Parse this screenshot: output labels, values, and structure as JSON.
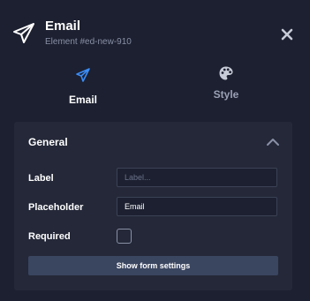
{
  "header": {
    "title": "Email",
    "subtitle": "Element #ed-new-910",
    "icon": "paper-plane-icon",
    "close_icon": "close-icon"
  },
  "tabs": [
    {
      "label": "Email",
      "icon": "paper-plane-icon",
      "active": true,
      "color": "#3b8cf5"
    },
    {
      "label": "Style",
      "icon": "palette-icon",
      "active": false,
      "color": "#b8bccb"
    }
  ],
  "section": {
    "title": "General",
    "expanded": true,
    "fields": {
      "label": {
        "label": "Label",
        "value": "",
        "placeholder": "Label..."
      },
      "placeholder": {
        "label": "Placeholder",
        "value": "Email",
        "placeholder": ""
      },
      "required": {
        "label": "Required",
        "checked": false
      }
    },
    "button_label": "Show form settings"
  },
  "colors": {
    "background": "#1c2030",
    "section_bg": "#242838",
    "accent": "#3b8cf5",
    "button_bg": "#3a4560"
  }
}
